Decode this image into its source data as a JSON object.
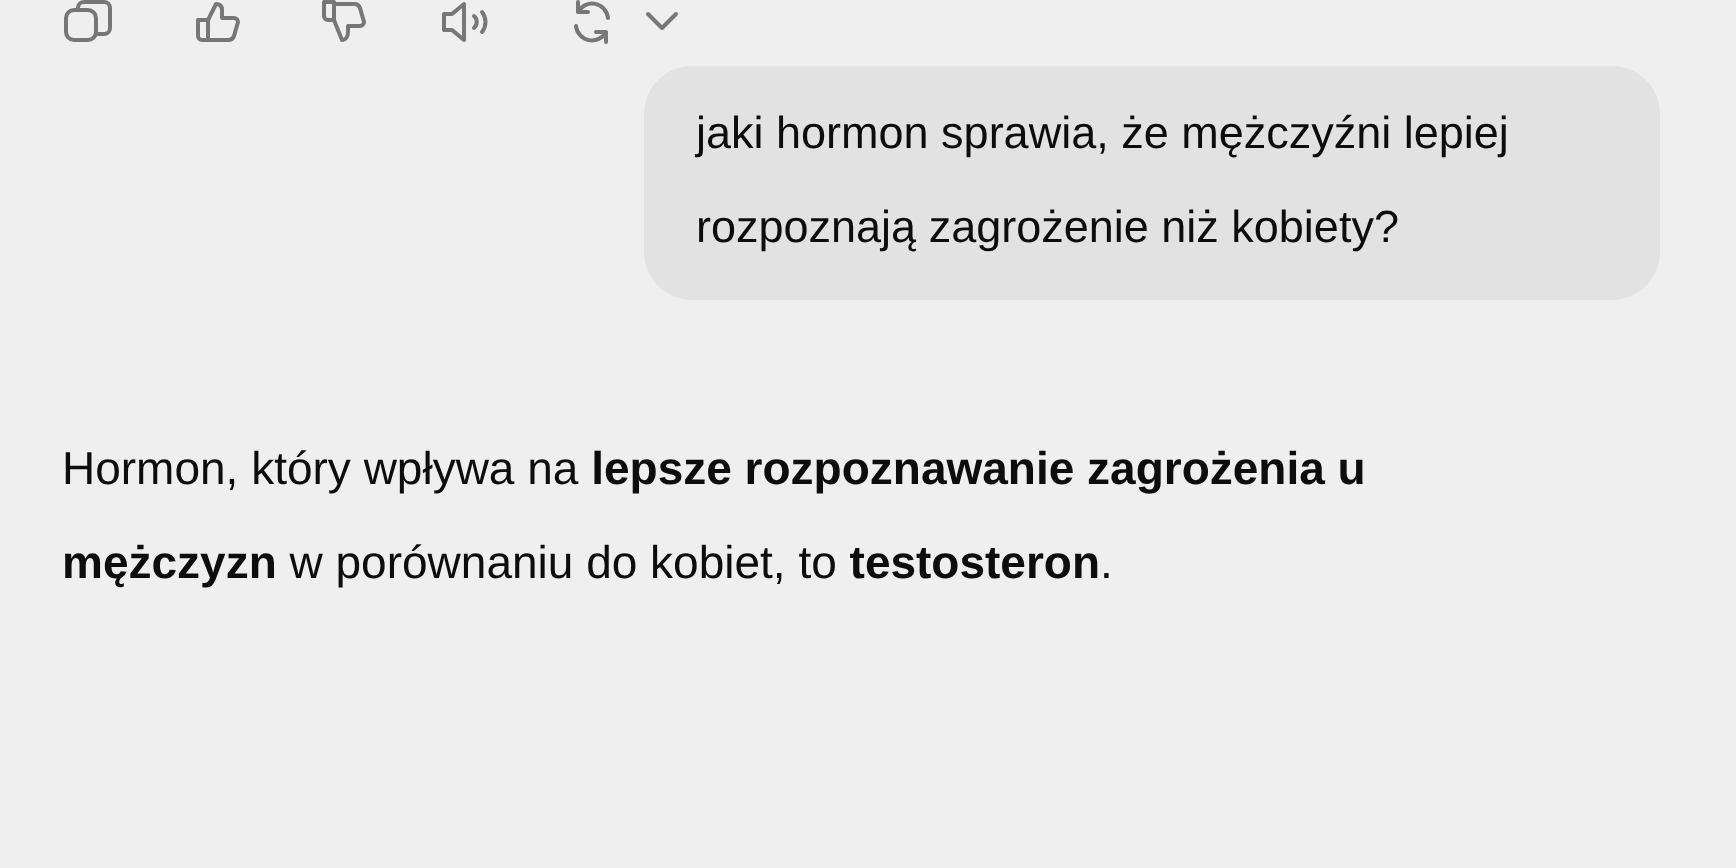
{
  "user_message": {
    "text": "jaki hormon sprawia, że mężczyźni lepiej rozpoznają zagrożenie niż kobiety?"
  },
  "assistant_message": {
    "text": "Hormon, który wpływa na **lepsze rozpoznawanie zagrożenia u mężczyzn** w porównaniu do kobiet, to **testosteron**."
  }
}
